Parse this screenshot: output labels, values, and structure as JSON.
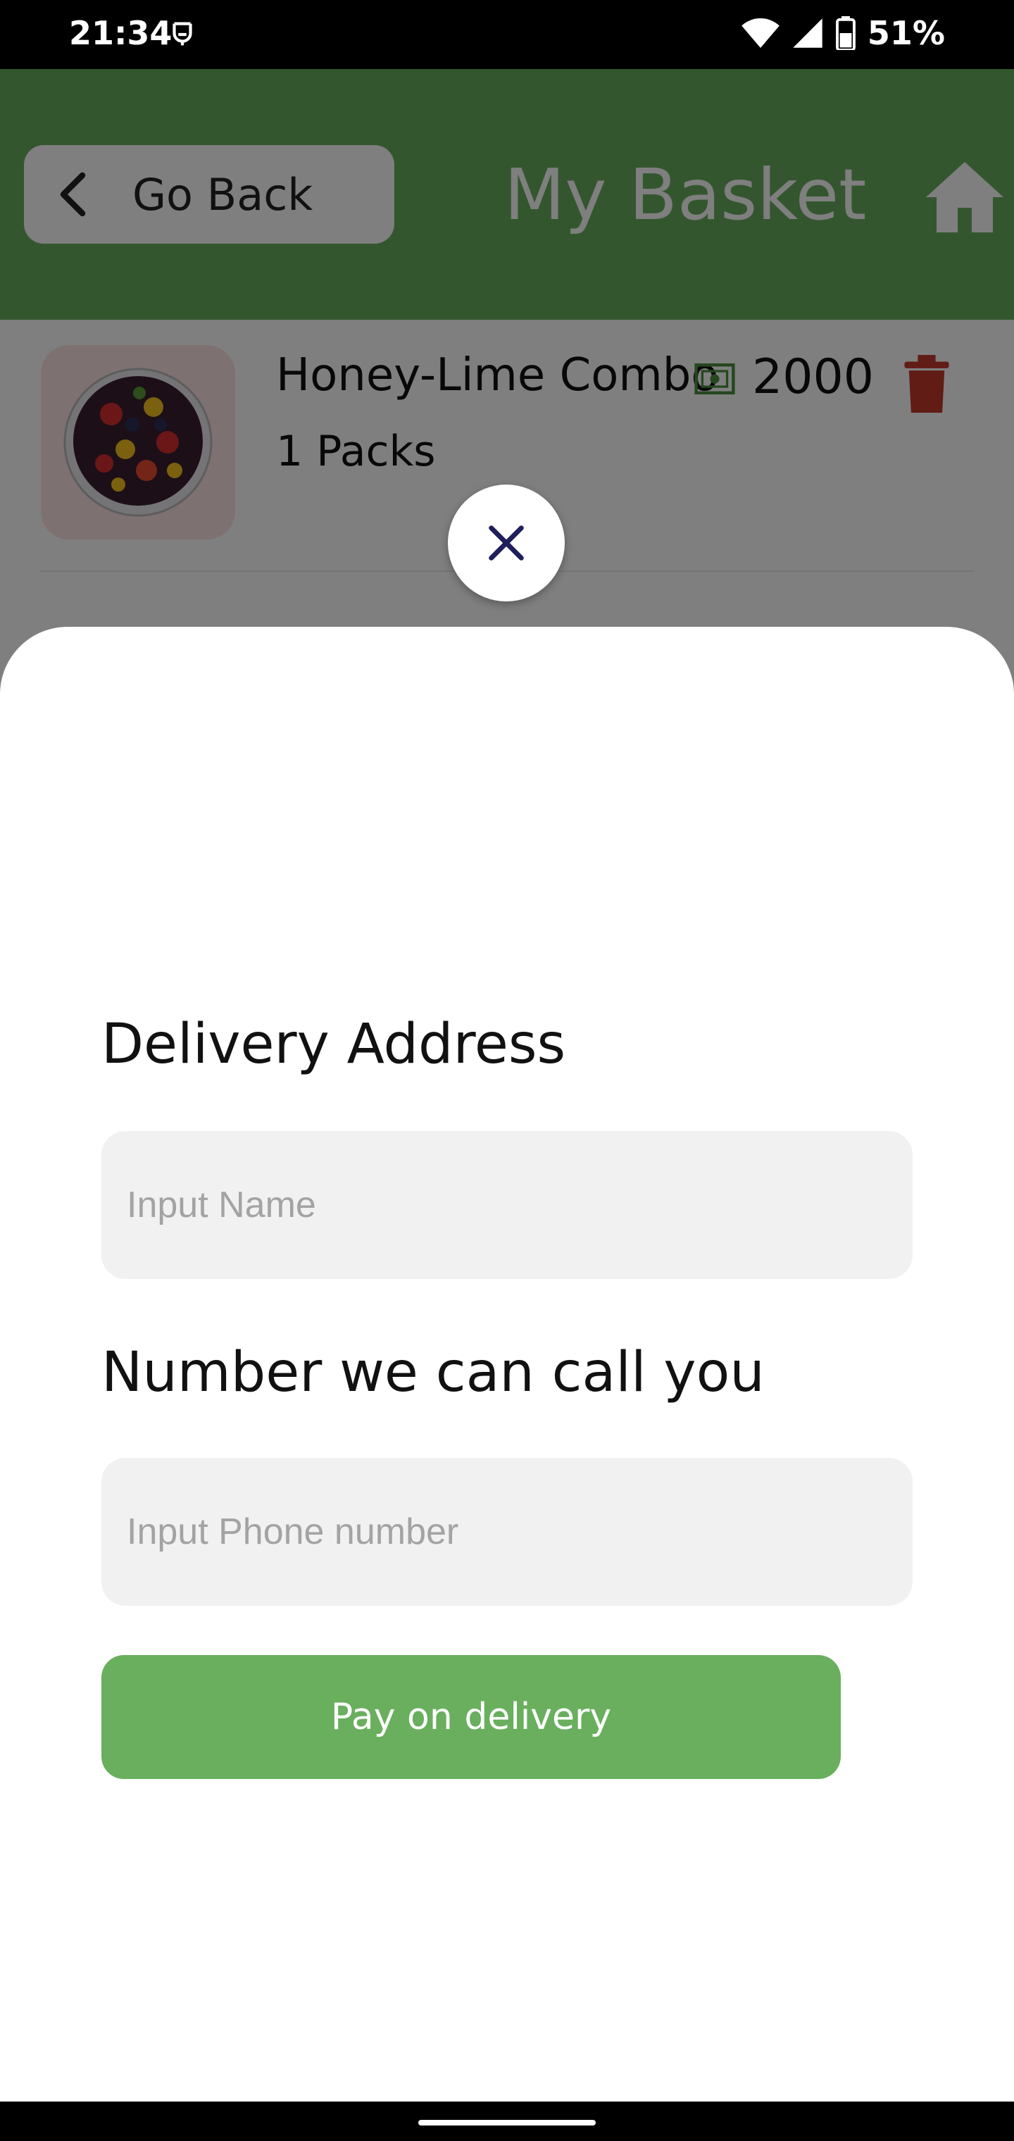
{
  "status_bar": {
    "time": "21:34",
    "battery": "51%"
  },
  "header": {
    "back_label": "Go Back",
    "title": "My Basket"
  },
  "basket_item": {
    "name": "Honey-Lime Combo",
    "price": "2000",
    "quantity": "1 Packs"
  },
  "sheet": {
    "address_label": "Delivery Address",
    "name_placeholder": "Input Name",
    "phone_label": "Number we can call you",
    "phone_placeholder": "Input Phone number",
    "pay_button": "Pay on delivery"
  },
  "colors": {
    "header_green": "#68ac5e",
    "button_green": "#69af5e",
    "trash_red": "#c0392b",
    "close_icon": "#1f1f5c"
  }
}
